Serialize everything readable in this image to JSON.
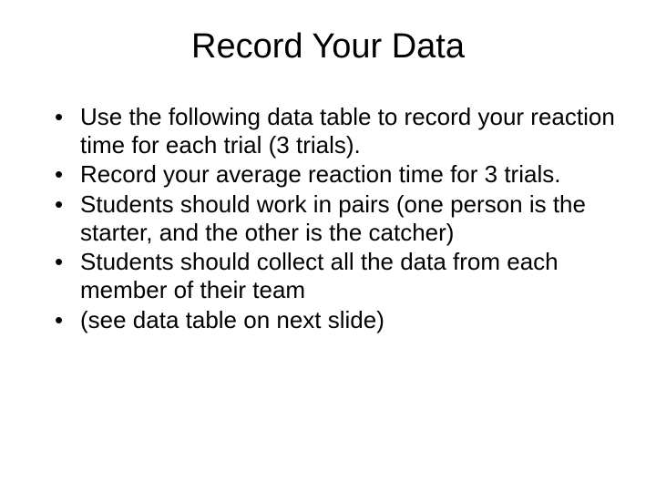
{
  "title": "Record Your Data",
  "bullets": [
    "Use the following data table to record your reaction time for each trial (3 trials).",
    "Record your average reaction time for 3 trials.",
    "Students should work in pairs (one person is the starter, and the other is the catcher)",
    "Students should collect all the data from each member of their team",
    "(see data table on next slide)"
  ]
}
